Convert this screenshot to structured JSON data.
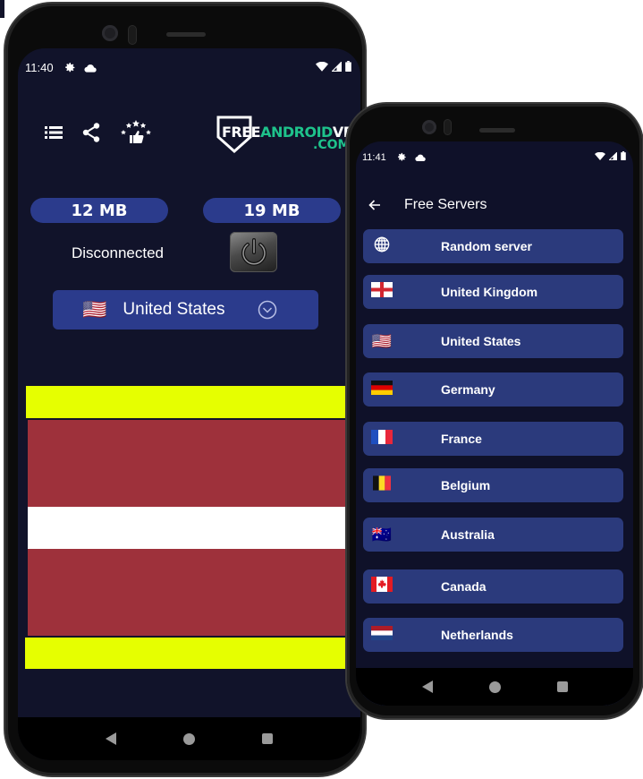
{
  "phone_main": {
    "status_bar": {
      "time": "11:40",
      "left_icons": [
        "gear-icon",
        "cloud-icon"
      ],
      "right_icons": [
        "wifi-icon",
        "signal-icon",
        "battery-icon"
      ]
    },
    "toolbar": {
      "icons": [
        "list-icon",
        "share-icon",
        "rate-stars-thumbs-up-icon"
      ]
    },
    "logo": {
      "free": "FREE",
      "android": "ANDROID",
      "vpn": "VPN",
      "com": ".COM"
    },
    "traffic": {
      "download": "12 MB",
      "upload": "19 MB"
    },
    "connection_status": "Disconnected",
    "power_button": "power-icon",
    "country_selector": {
      "flag": "🇺🇸",
      "selected": "United States"
    },
    "banner_colors": {
      "yellow": "#e6ff00",
      "red": "#9e313b",
      "white": "#ffffff"
    }
  },
  "phone_servers": {
    "status_bar": {
      "time": "11:41",
      "left_icons": [
        "gear-icon",
        "cloud-icon"
      ],
      "right_icons": [
        "wifi-icon",
        "signal-icon",
        "battery-icon"
      ]
    },
    "header": {
      "title": "Free Servers"
    },
    "servers": [
      {
        "flag": "globe",
        "name": "Random server"
      },
      {
        "flag": "🏴",
        "name": "United Kingdom"
      },
      {
        "flag": "🇺🇸",
        "name": "United States"
      },
      {
        "flag": "🇩🇪",
        "name": "Germany"
      },
      {
        "flag": "🇫🇷",
        "name": "France"
      },
      {
        "flag": "🇧🇪",
        "name": "Belgium"
      },
      {
        "flag": "🇦🇺",
        "name": "Australia"
      },
      {
        "flag": "🇨🇦",
        "name": "Canada"
      },
      {
        "flag": "🇳🇱",
        "name": "Netherlands"
      },
      {
        "flag": "",
        "name": ""
      }
    ]
  },
  "colors": {
    "background": "#11132a",
    "accent": "#2b3b8c",
    "list_item": "#2b3a7c",
    "logo_green": "#1ec28b"
  }
}
